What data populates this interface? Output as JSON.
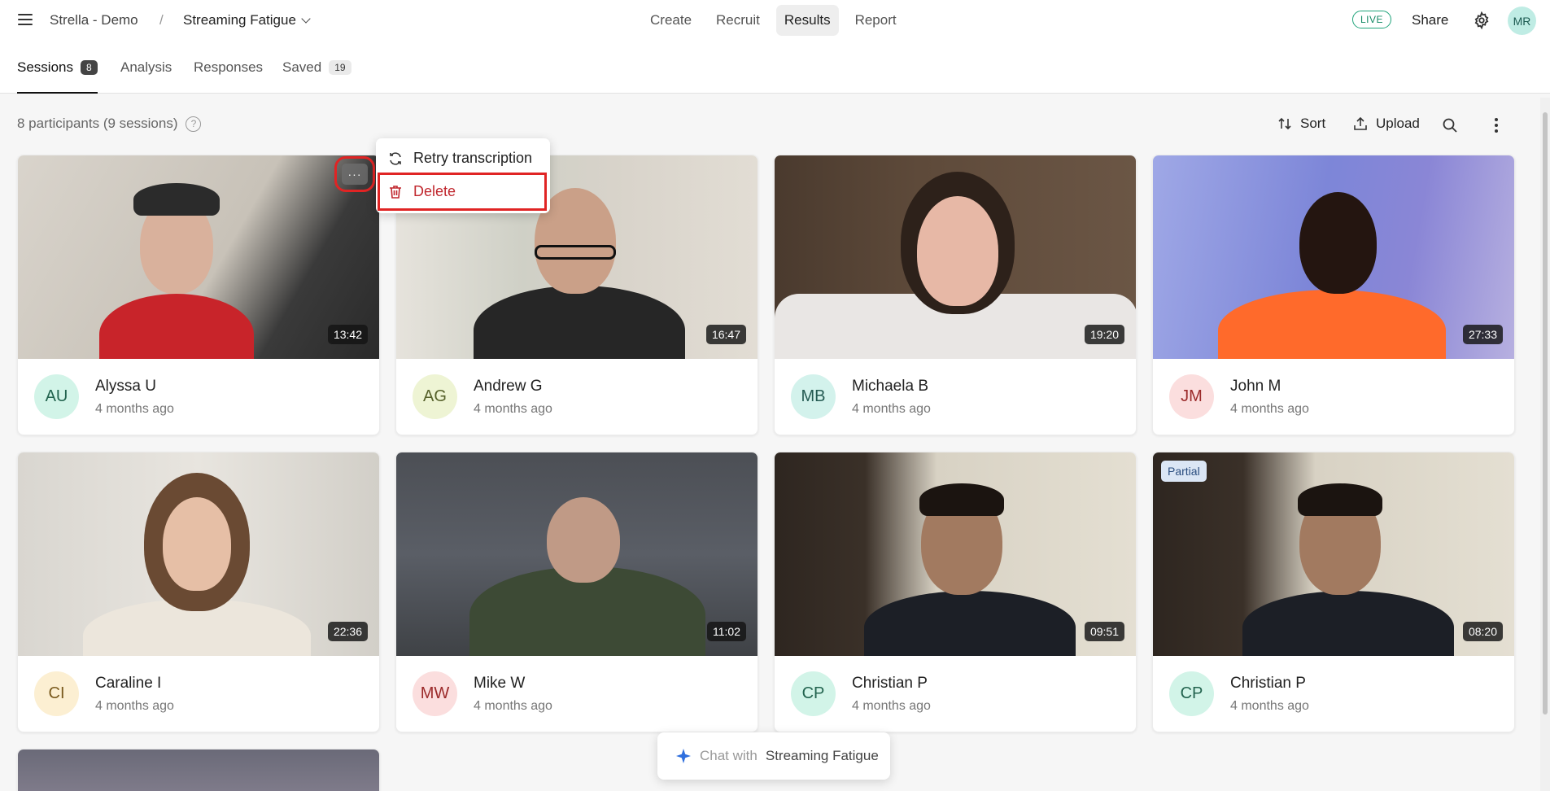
{
  "topbar": {
    "org": "Strella - Demo",
    "separator": "/",
    "study": "Streaming Fatigue",
    "nav": [
      "Create",
      "Recruit",
      "Results",
      "Report"
    ],
    "active_nav": "Results",
    "live": "LIVE",
    "share": "Share",
    "user_initials": "MR"
  },
  "tabs": [
    {
      "label": "Sessions",
      "count": "8"
    },
    {
      "label": "Analysis",
      "count": ""
    },
    {
      "label": "Responses",
      "count": ""
    },
    {
      "label": "Saved",
      "count": "19"
    }
  ],
  "toolbar": {
    "summary": "8 participants (9 sessions)",
    "help": "?",
    "sort": "Sort",
    "upload": "Upload"
  },
  "menu": {
    "retry": "Retry transcription",
    "delete": "Delete"
  },
  "sessions": [
    {
      "initials": "AU",
      "name": "Alyssa U",
      "time": "4 months ago",
      "duration": "13:42",
      "avatar_bg": "#d2f4e8",
      "avatar_fg": "#22634e",
      "more": "···"
    },
    {
      "initials": "AG",
      "name": "Andrew G",
      "time": "4 months ago",
      "duration": "16:47",
      "avatar_bg": "#eef4d4",
      "avatar_fg": "#56612a"
    },
    {
      "initials": "MB",
      "name": "Michaela B",
      "time": "4 months ago",
      "duration": "19:20",
      "avatar_bg": "#d3f2ec",
      "avatar_fg": "#245a52"
    },
    {
      "initials": "JM",
      "name": "John M",
      "time": "4 months ago",
      "duration": "27:33",
      "avatar_bg": "#fbdede",
      "avatar_fg": "#9b2a2a"
    },
    {
      "initials": "CI",
      "name": "Caraline I",
      "time": "4 months ago",
      "duration": "22:36",
      "avatar_bg": "#fcefd2",
      "avatar_fg": "#7a5a1d"
    },
    {
      "initials": "MW",
      "name": "Mike W",
      "time": "4 months ago",
      "duration": "11:02",
      "avatar_bg": "#fbdede",
      "avatar_fg": "#9b2a2a"
    },
    {
      "initials": "CP",
      "name": "Christian P",
      "time": "4 months ago",
      "duration": "09:51",
      "avatar_bg": "#d2f4e8",
      "avatar_fg": "#22634e"
    },
    {
      "initials": "CP",
      "name": "Christian P",
      "time": "4 months ago",
      "duration": "08:20",
      "avatar_bg": "#d2f4e8",
      "avatar_fg": "#22634e",
      "badge": "Partial"
    }
  ],
  "chat": {
    "prefix": "Chat with",
    "study": "Streaming Fatigue"
  }
}
